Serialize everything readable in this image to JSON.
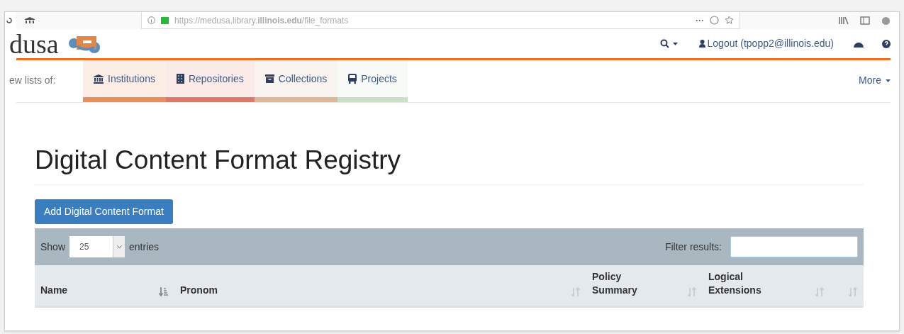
{
  "browser": {
    "url": "https://medusa.library.**illinois.edu**/file_formats",
    "menu": "···"
  },
  "header": {
    "logo_text": "dusa",
    "logout": "Logout (tpopp2@illinois.edu)"
  },
  "nav": {
    "label": "ew lists of:",
    "more": "More",
    "tabs": [
      {
        "label": "Institutions",
        "kind": "bank",
        "color": "#e8905a"
      },
      {
        "label": "Repositories",
        "kind": "building",
        "color": "#dc7a6a"
      },
      {
        "label": "Collections",
        "kind": "archive",
        "color": "#dcb898"
      },
      {
        "label": "Projects",
        "kind": "bus",
        "color": "#c9e0c6"
      }
    ]
  },
  "page": {
    "title": "Digital Content Format Registry",
    "add_button": "Add Digital Content Format"
  },
  "table": {
    "show_label": "Show",
    "page_size": "25",
    "entries_label": "entries",
    "filter_label": "Filter results:",
    "columns": [
      {
        "label": "Name",
        "sorted": true
      },
      {
        "label": "Pronom",
        "sorted": false
      },
      {
        "label": "Policy Summary",
        "sorted": false
      },
      {
        "label": "Logical Extensions",
        "sorted": false
      },
      {
        "sorted": false
      }
    ]
  }
}
